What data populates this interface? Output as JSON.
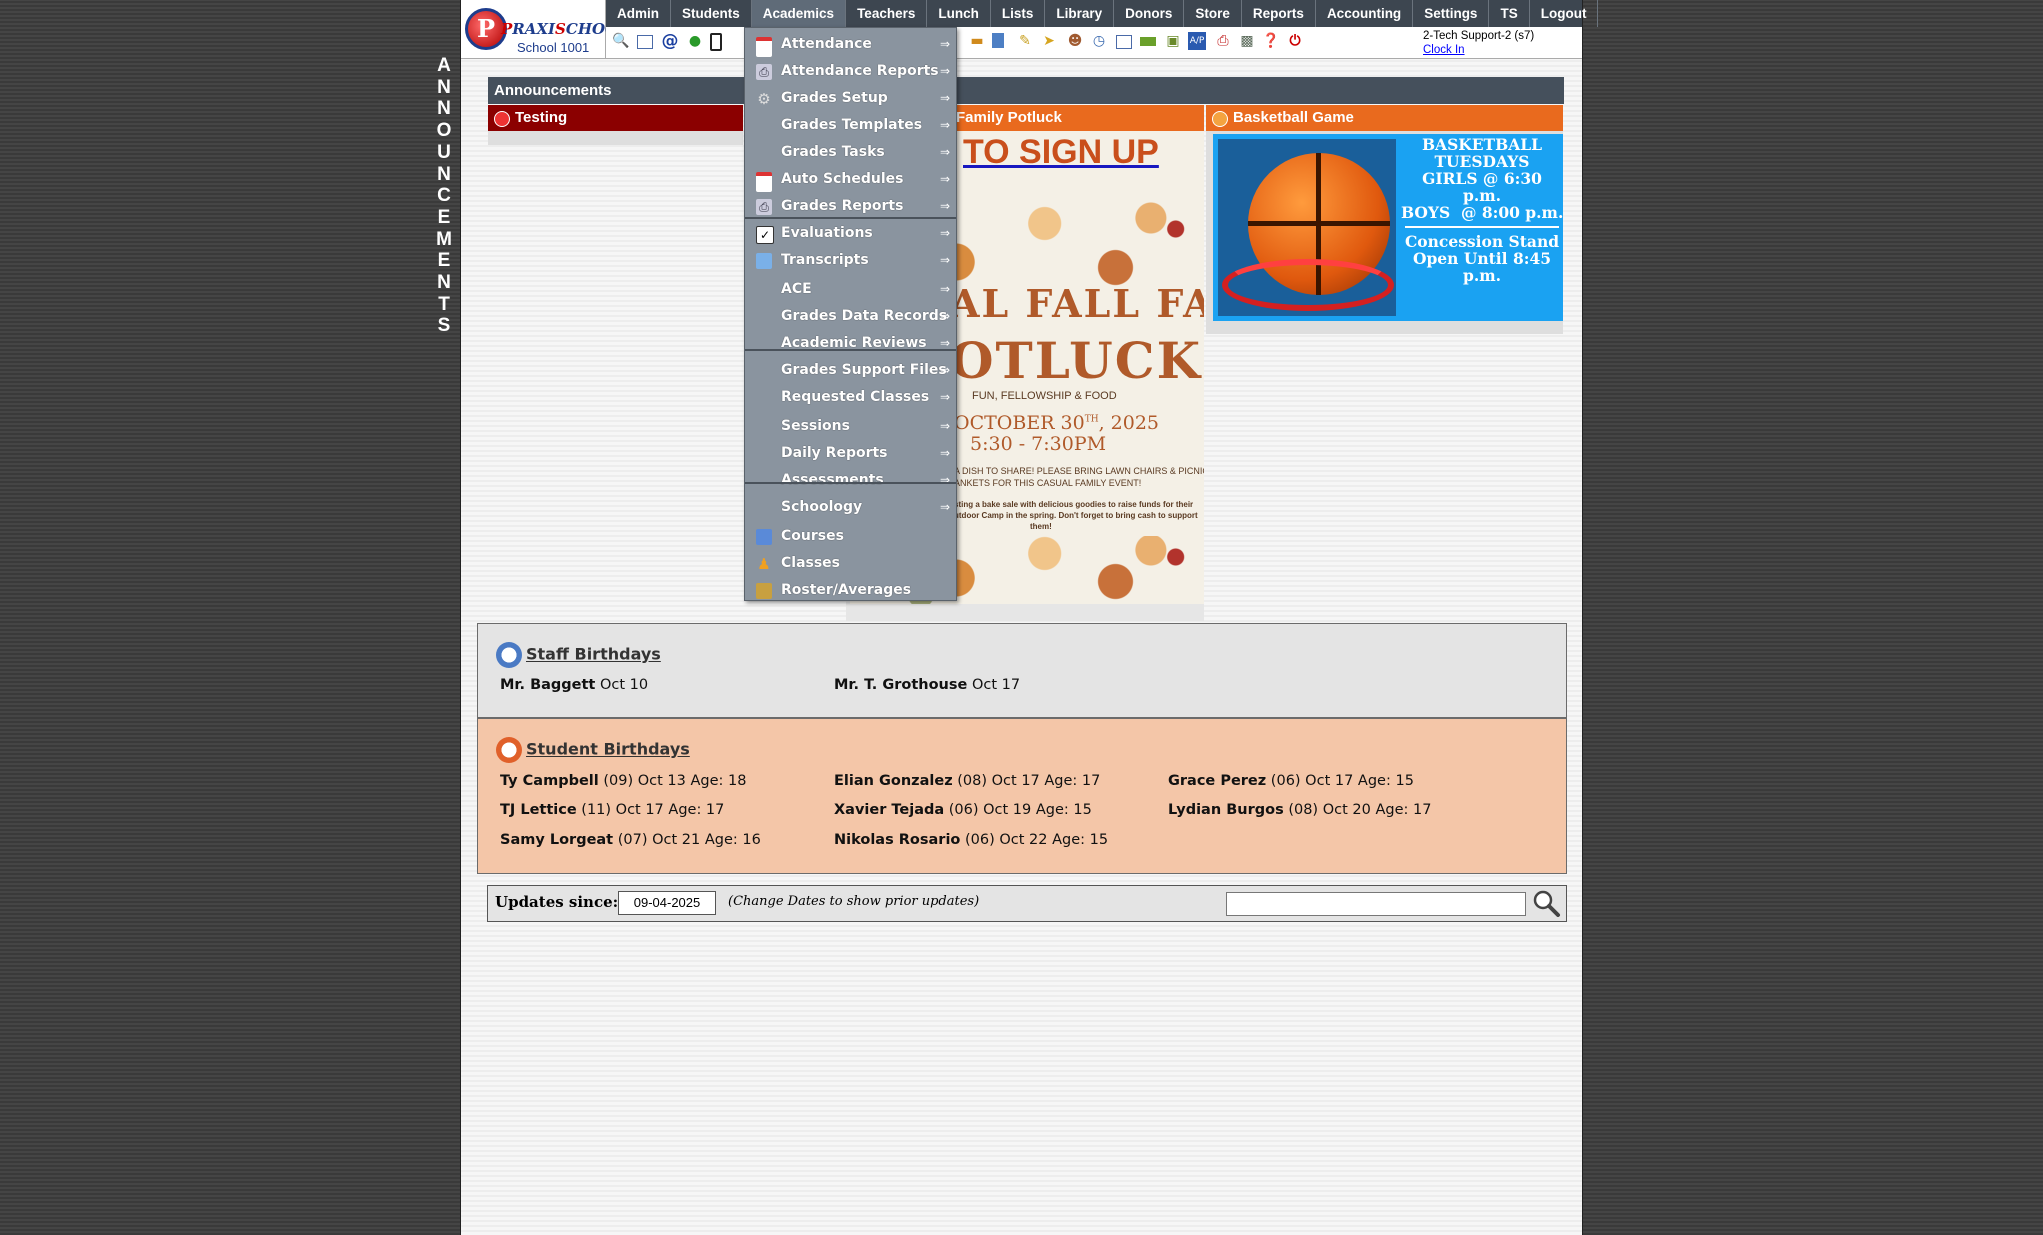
{
  "vertical_label": [
    "A",
    "N",
    "N",
    "O",
    "U",
    "N",
    "C",
    "E",
    "M",
    "E",
    "N",
    "T",
    "S"
  ],
  "logo": {
    "mark": "P",
    "name_part1": "P",
    "name_part2": "RAXI",
    "name_part3": "S",
    "name_part4": "CHOOL",
    "tm": "®",
    "school": "School 1001"
  },
  "menubar": [
    "Admin",
    "Students",
    "Academics",
    "Teachers",
    "Lunch",
    "Lists",
    "Library",
    "Donors",
    "Store",
    "Reports",
    "Accounting",
    "Settings",
    "TS",
    "Logout"
  ],
  "user": {
    "name": "2-Tech Support-2 (s7)",
    "clock_in": "Clock In"
  },
  "announcements": {
    "header": "Announcements",
    "columns": [
      {
        "title": "Testing",
        "color": "#8b0000"
      },
      {
        "title": "Family Potluck",
        "color": "#e96a1e"
      },
      {
        "title": "Basketball Game",
        "color": "#e96a1e"
      }
    ],
    "potluck": {
      "signup": "TO SIGN UP",
      "title1": "AL FALL FAMILY",
      "title2": "OTLUCK",
      "tagline": "FUN, FELLOWSHIP & FOOD",
      "date_main": "OCTOBER 30",
      "date_sup": "TH",
      "date_year": ", 2025",
      "time": "5:30 - 7:30PM",
      "line1": "A DISH TO SHARE! PLEASE BRING LAWN CHAIRS & PICNIC",
      "line2": "ANKETS FOR THIS CASUAL FAMILY EVENT!",
      "line3": "sting a bake sale with delicious goodies to raise funds for their",
      "line4": "utdoor Camp in the spring. Don't forget to bring cash to support",
      "line5": "them!"
    },
    "basketball": {
      "l1": "BASKETBALL",
      "l2": "TUESDAYS",
      "l3": "GIRLS @ 6:30 p.m.",
      "l4": "BOYS  @ 8:00 p.m.",
      "l5": "Concession Stand",
      "l6": "Open Until 8:45 p.m."
    }
  },
  "staff_birthdays": {
    "title": "Staff Birthdays",
    "entries": [
      {
        "name": "Mr. Baggett",
        "info": " Oct 10"
      },
      {
        "name": "Mr. T. Grothouse",
        "info": " Oct 17"
      }
    ]
  },
  "student_birthdays": {
    "title": "Student Birthdays",
    "entries": [
      {
        "name": "Ty Campbell",
        "info": " (09) Oct 13 Age: 18"
      },
      {
        "name": "Elian Gonzalez",
        "info": " (08) Oct 17 Age: 17"
      },
      {
        "name": "Grace Perez",
        "info": " (06) Oct 17 Age: 15"
      },
      {
        "name": "TJ Lettice",
        "info": " (11) Oct 17 Age: 17"
      },
      {
        "name": "Xavier Tejada",
        "info": " (06) Oct 19 Age: 15"
      },
      {
        "name": "Lydian Burgos",
        "info": " (08) Oct 20 Age: 17"
      },
      {
        "name": "Samy Lorgeat",
        "info": " (07) Oct 21 Age: 16"
      },
      {
        "name": "Nikolas Rosario",
        "info": " (06) Oct 22 Age: 15"
      }
    ]
  },
  "updates": {
    "label": "Updates since:",
    "date": "09-04-2025",
    "hint": "(Change Dates to show prior updates)",
    "search_value": ""
  },
  "dropdown": {
    "arrow": "⇒",
    "items": [
      {
        "label": "Attendance",
        "icon": "calendar-icon",
        "submenu": true
      },
      {
        "label": "Attendance Reports",
        "icon": "printer-icon",
        "submenu": true
      },
      {
        "label": "Grades Setup",
        "icon": "gear-icon",
        "submenu": true
      },
      {
        "label": "Grades Templates",
        "icon": "",
        "submenu": true
      },
      {
        "label": "Grades Tasks",
        "icon": "",
        "submenu": true
      },
      {
        "label": "Auto Schedules",
        "icon": "calendar-clock-icon",
        "submenu": true
      },
      {
        "label": "Grades Reports",
        "icon": "printer-icon",
        "submenu": true
      },
      {
        "label": "Evaluations",
        "icon": "checkbox-icon",
        "submenu": true
      },
      {
        "label": "Transcripts",
        "icon": "document-icon",
        "submenu": true
      },
      {
        "label": "ACE",
        "icon": "",
        "submenu": true
      },
      {
        "label": "Grades Data Records",
        "icon": "",
        "submenu": true
      },
      {
        "label": "Academic Reviews",
        "icon": "",
        "submenu": true
      },
      {
        "label": "Grades Support Files",
        "icon": "",
        "submenu": true
      },
      {
        "label": "Requested Classes",
        "icon": "",
        "submenu": true
      },
      {
        "label": "Sessions",
        "icon": "",
        "submenu": true
      },
      {
        "label": "Daily Reports",
        "icon": "",
        "submenu": true
      },
      {
        "label": "Assessments",
        "icon": "",
        "submenu": true
      },
      {
        "label": "Schoology",
        "icon": "",
        "submenu": true
      },
      {
        "label": "Courses",
        "icon": "book-icon",
        "submenu": false
      },
      {
        "label": "Classes",
        "icon": "person-icon",
        "submenu": false
      },
      {
        "label": "Roster/Averages",
        "icon": "roster-icon",
        "submenu": false
      }
    ]
  }
}
